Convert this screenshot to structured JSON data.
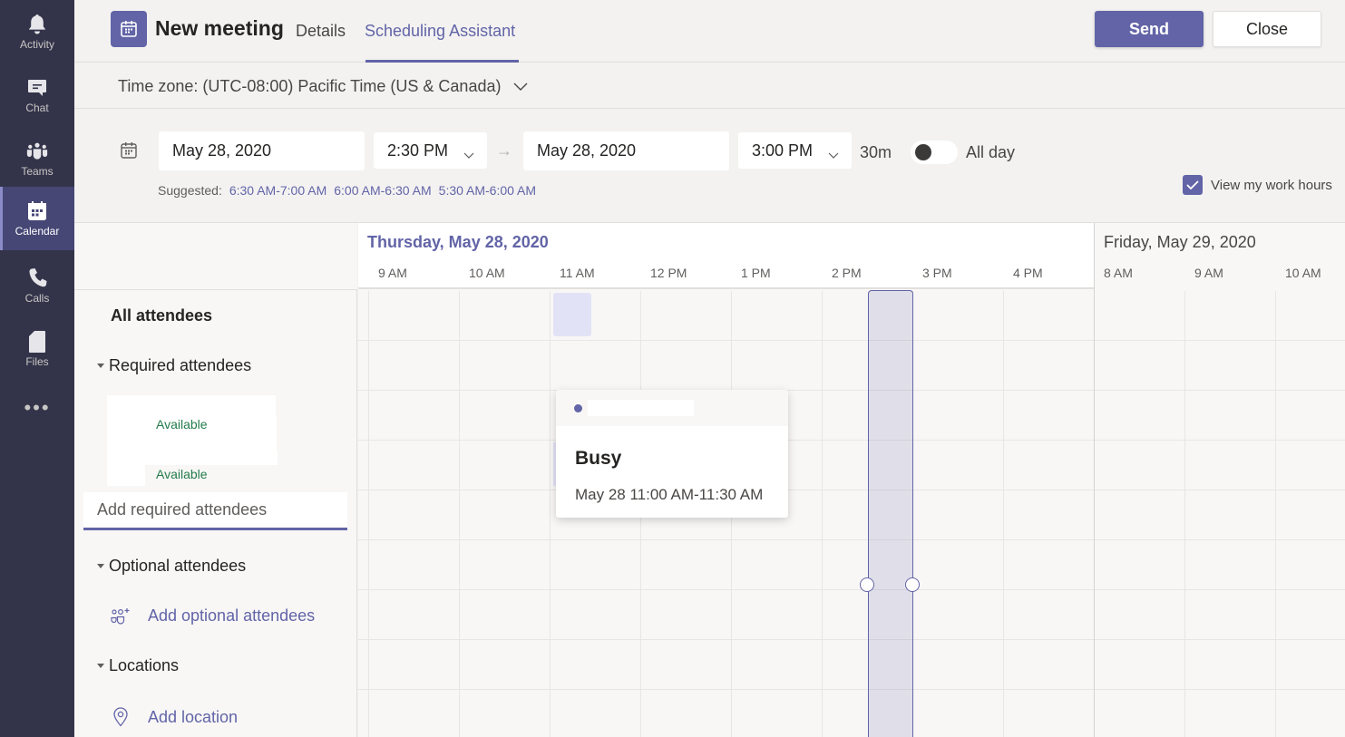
{
  "rail": {
    "items": [
      {
        "label": "Activity",
        "icon": "bell-icon",
        "active": false
      },
      {
        "label": "Chat",
        "icon": "chat-icon",
        "active": false
      },
      {
        "label": "Teams",
        "icon": "teams-icon",
        "active": false
      },
      {
        "label": "Calendar",
        "icon": "calendar-icon",
        "active": true
      },
      {
        "label": "Calls",
        "icon": "phone-icon",
        "active": false
      },
      {
        "label": "Files",
        "icon": "file-icon",
        "active": false
      }
    ],
    "more_label": "•••"
  },
  "header": {
    "title": "New meeting",
    "tabs": [
      {
        "label": "Details",
        "active": false
      },
      {
        "label": "Scheduling Assistant",
        "active": true
      }
    ],
    "send_label": "Send",
    "close_label": "Close"
  },
  "timezone": {
    "label": "Time zone: (UTC-08:00) Pacific Time (US & Canada)"
  },
  "datetime": {
    "start_date": "May 28, 2020",
    "start_time": "2:30 PM",
    "arrow": "→",
    "end_date": "May 28, 2020",
    "end_time": "3:00 PM",
    "duration": "30m",
    "all_day_label": "All day",
    "all_day_on": false,
    "suggested_label": "Suggested:",
    "suggested_slots": [
      "6:30 AM-7:00 AM",
      "6:00 AM-6:30 AM",
      "5:30 AM-6:00 AM"
    ],
    "view_work_hours_label": "View my work hours",
    "view_work_hours_checked": true
  },
  "attendees": {
    "all_label": "All attendees",
    "required_label": "Required attendees",
    "required": [
      {
        "status": "Available"
      },
      {
        "status": "Available"
      }
    ],
    "add_required_placeholder": "Add required attendees",
    "optional_label": "Optional attendees",
    "add_optional_label": "Add optional attendees",
    "locations_label": "Locations",
    "add_location_label": "Add location"
  },
  "schedule": {
    "days": [
      {
        "label": "Thursday, May 28, 2020",
        "hours": [
          "9 AM",
          "10 AM",
          "11 AM",
          "12 PM",
          "1 PM",
          "2 PM",
          "3 PM",
          "4 PM"
        ]
      },
      {
        "label": "Friday, May 29, 2020",
        "hours": [
          "8 AM",
          "9 AM",
          "10 AM"
        ]
      }
    ],
    "selected_range": {
      "start": "2:30 PM",
      "end": "3:00 PM"
    },
    "busy_blocks": [
      {
        "start": "11:00 AM",
        "end": "11:30 AM"
      }
    ]
  },
  "popup": {
    "status": "Busy",
    "time": "May 28 11:00 AM-11:30 AM"
  },
  "colors": {
    "accent": "#6264a7",
    "rail_bg": "#33344a",
    "available": "#237b4b",
    "busy_fill": "#e2e2f6"
  }
}
